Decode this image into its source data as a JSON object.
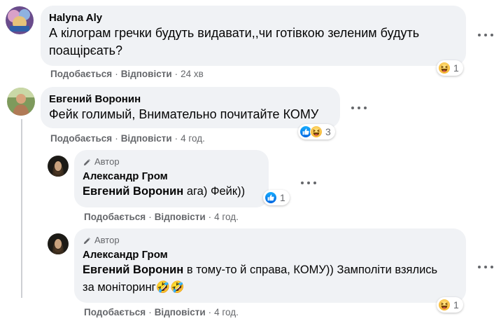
{
  "comments": [
    {
      "author": "Halyna Aly",
      "text": "А кілограм гречки будуть видавати,,чи готівкою зеленим будуть поащірєать?",
      "actions": {
        "like": "Подобається",
        "reply": "Відповісти",
        "time": "24 хв"
      },
      "reactions": {
        "icons": [
          "haha-icon"
        ],
        "count": "1"
      }
    },
    {
      "author": "Евгений Воронин",
      "text": "Фейк голимый, Внимательно почитайте КОМУ",
      "actions": {
        "like": "Подобається",
        "reply": "Відповісти",
        "time": "4 год."
      },
      "reactions": {
        "icons": [
          "like-icon",
          "haha-icon"
        ],
        "count": "3"
      }
    }
  ],
  "replies": [
    {
      "badge": "Автор",
      "author": "Александр Гром",
      "mention": "Евгений Воронин",
      "text": " ага) Фейк))",
      "actions": {
        "like": "Подобається",
        "reply": "Відповісти",
        "time": "4 год."
      },
      "reactions": {
        "icons": [
          "like-icon"
        ],
        "count": "1"
      }
    },
    {
      "badge": "Автор",
      "author": "Александр Гром",
      "mention": "Евгений Воронин",
      "text": " в тому-то й справа, КОМУ)) Замполіти взялись за моніторинг🤣🤣",
      "actions": {
        "like": "Подобається",
        "reply": "Відповісти",
        "time": "4 год."
      },
      "reactions": {
        "icons": [
          "haha-icon"
        ],
        "count": "1"
      }
    }
  ],
  "separator": "·"
}
